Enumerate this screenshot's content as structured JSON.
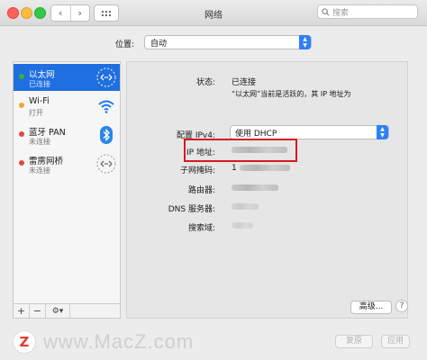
{
  "window": {
    "title": "网络"
  },
  "search": {
    "placeholder": "搜索"
  },
  "location": {
    "label": "位置:",
    "value": "自动"
  },
  "sidebar": {
    "items": [
      {
        "name": "以太网",
        "status": "已连接",
        "dot": "#36b336",
        "icon": "ethernet-icon",
        "selected": true
      },
      {
        "name": "Wi-Fi",
        "status": "打开",
        "dot": "#f2a33a",
        "icon": "wifi-icon",
        "selected": false
      },
      {
        "name": "蓝牙 PAN",
        "status": "未连接",
        "dot": "#e04a3f",
        "icon": "bluetooth-icon",
        "selected": false
      },
      {
        "name": "雷雳网桥",
        "status": "未连接",
        "dot": "#e04a3f",
        "icon": "thunderbolt-bridge-icon",
        "selected": false
      }
    ],
    "add": "+",
    "remove": "−",
    "action": "⚙▾"
  },
  "detail": {
    "status_label": "状态:",
    "status_value": "已连接",
    "status_desc": "“以太网”当前是活跃的，其 IP 地址为",
    "config_label": "配置 IPv4:",
    "config_value": "使用 DHCP",
    "ip_label": "IP 地址:",
    "subnet_label": "子网掩码:",
    "subnet_value_partial": "1",
    "router_label": "路由器:",
    "dns_label": "DNS 服务器:",
    "search_domain_label": "搜索域:"
  },
  "buttons": {
    "advanced": "高级...",
    "help": "?",
    "revert": "复原",
    "apply": "应用"
  },
  "watermark": {
    "text": "www.MacZ.com",
    "logo": "Z"
  },
  "colors": {
    "accent": "#1f6fe0",
    "highlight": "#d71920"
  }
}
